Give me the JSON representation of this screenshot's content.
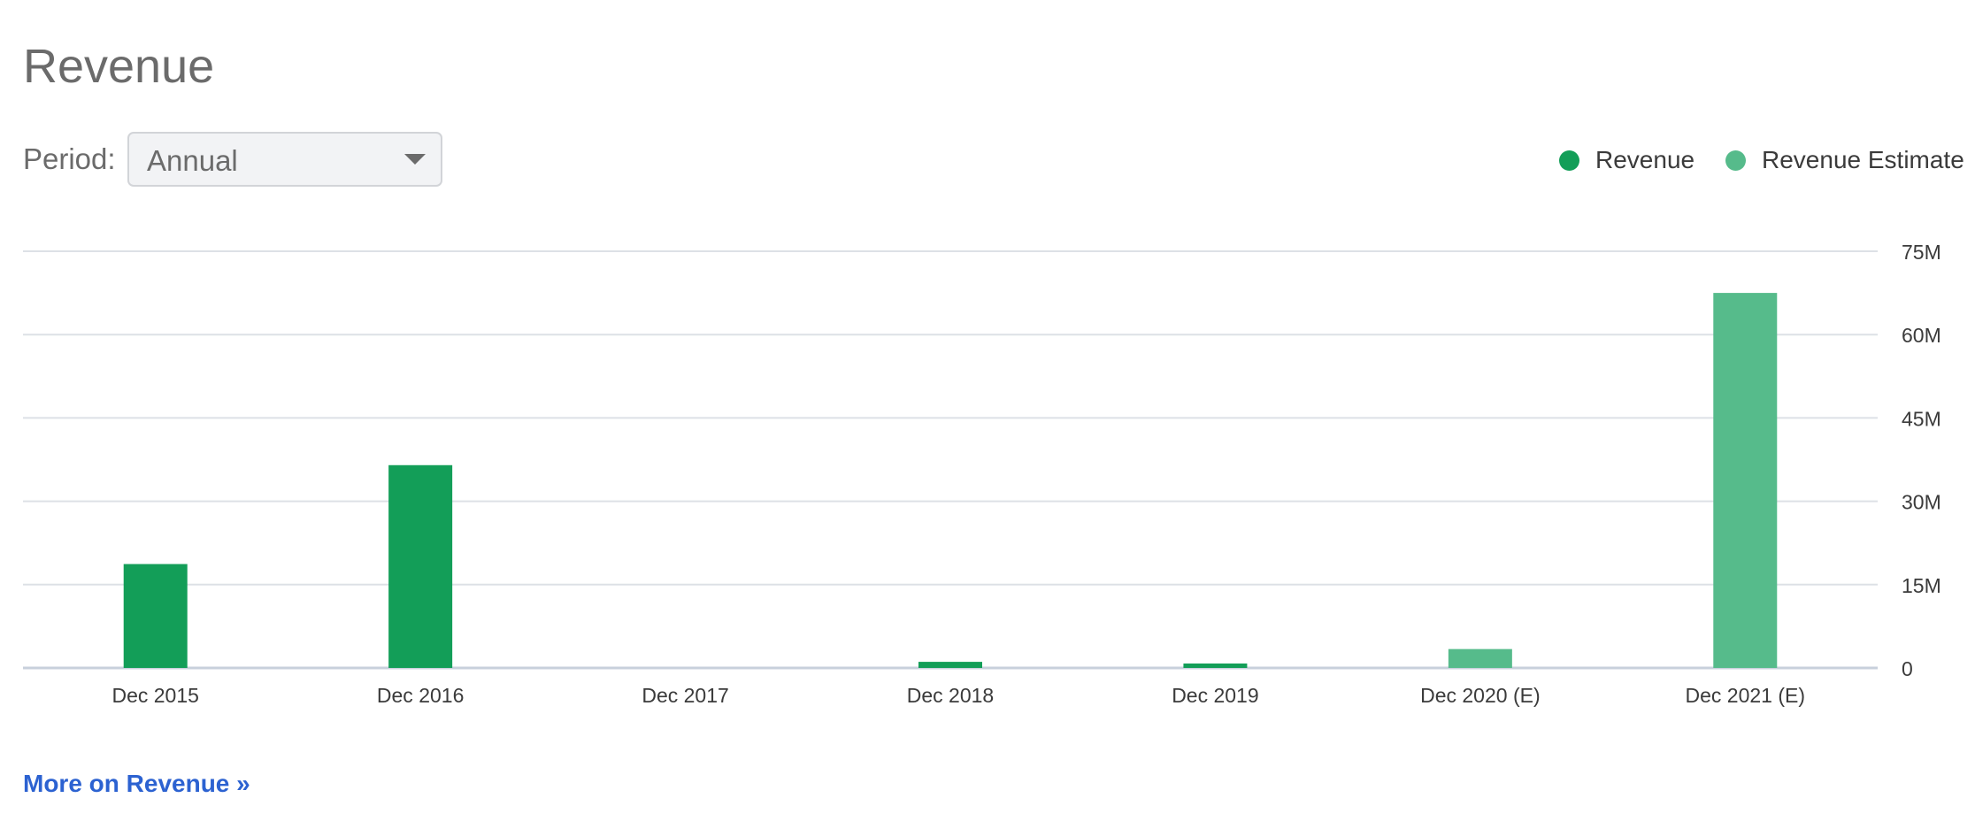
{
  "header": {
    "title": "Revenue"
  },
  "period": {
    "label": "Period:",
    "value": "Annual"
  },
  "legend": [
    {
      "label": "Revenue",
      "color": "#139e58"
    },
    {
      "label": "Revenue Estimate",
      "color": "#56bb8b"
    }
  ],
  "chart_data": {
    "type": "bar",
    "categories": [
      "Dec 2015",
      "Dec 2016",
      "Dec 2017",
      "Dec 2018",
      "Dec 2019",
      "Dec 2020 (E)",
      "Dec 2021 (E)"
    ],
    "series": [
      {
        "name": "Revenue",
        "color": "#139e58",
        "values": [
          18.7,
          36.5,
          0,
          1.1,
          0.8,
          null,
          null
        ]
      },
      {
        "name": "Revenue Estimate",
        "color": "#56bb8b",
        "values": [
          null,
          null,
          null,
          null,
          null,
          3.4,
          67.5
        ]
      }
    ],
    "ylim": [
      0,
      75
    ],
    "yticks": [
      0,
      15,
      30,
      45,
      60,
      75
    ],
    "ytick_labels": [
      "0",
      "15M",
      "30M",
      "45M",
      "60M",
      "75M"
    ],
    "y_axis_position": "right",
    "grid": true,
    "legend_position": "top-right"
  },
  "footer": {
    "link": "More on Revenue »"
  }
}
